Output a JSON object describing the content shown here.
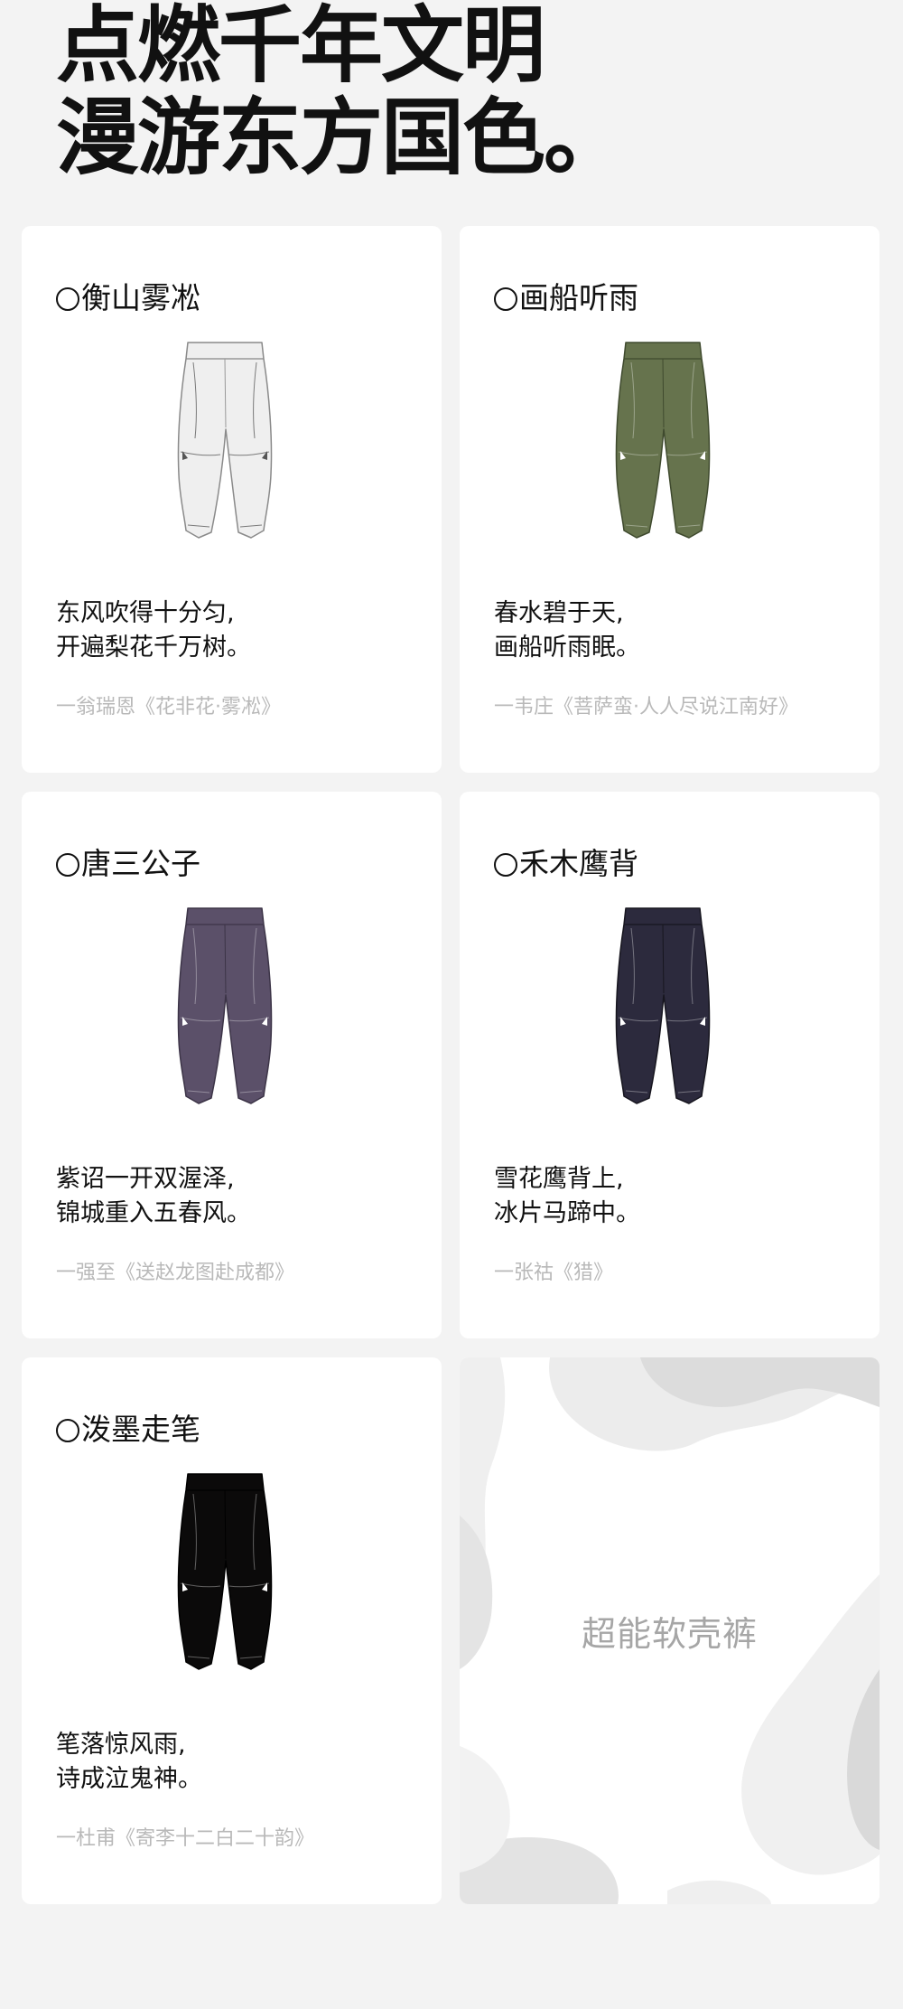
{
  "headline": {
    "line1": "点燃千年文明",
    "line2": "漫游东方国色。"
  },
  "products": [
    {
      "name": "衡山雾凇",
      "color": "#efefef",
      "stroke": "#8a8a8a",
      "poem_line1": "东风吹得十分匀,",
      "poem_line2": "开遍梨花千万树。",
      "source": "一翁瑞恩《花非花·雾凇》"
    },
    {
      "name": "画船听雨",
      "color": "#66734d",
      "stroke": "#3f4a2e",
      "poem_line1": "春水碧于天,",
      "poem_line2": "画船听雨眠。",
      "source": "一韦庄《菩萨蛮·人人尽说江南好》"
    },
    {
      "name": "唐三公子",
      "color": "#5b5069",
      "stroke": "#3c3447",
      "poem_line1": "紫诏一开双渥泽,",
      "poem_line2": "锦城重入五春风。",
      "source": "一强至《送赵龙图赴成都》"
    },
    {
      "name": "禾木鹰背",
      "color": "#2c2a3d",
      "stroke": "#17161f",
      "poem_line1": "雪花鹰背上,",
      "poem_line2": "冰片马蹄中。",
      "source": "一张祜《猎》"
    },
    {
      "name": "泼墨走笔",
      "color": "#0b0a0a",
      "stroke": "#000000",
      "poem_line1": "笔落惊风雨,",
      "poem_line2": "诗成泣鬼神。",
      "source": "一杜甫《寄李十二白二十韵》"
    }
  ],
  "camo_card": {
    "label": "超能软壳裤"
  }
}
